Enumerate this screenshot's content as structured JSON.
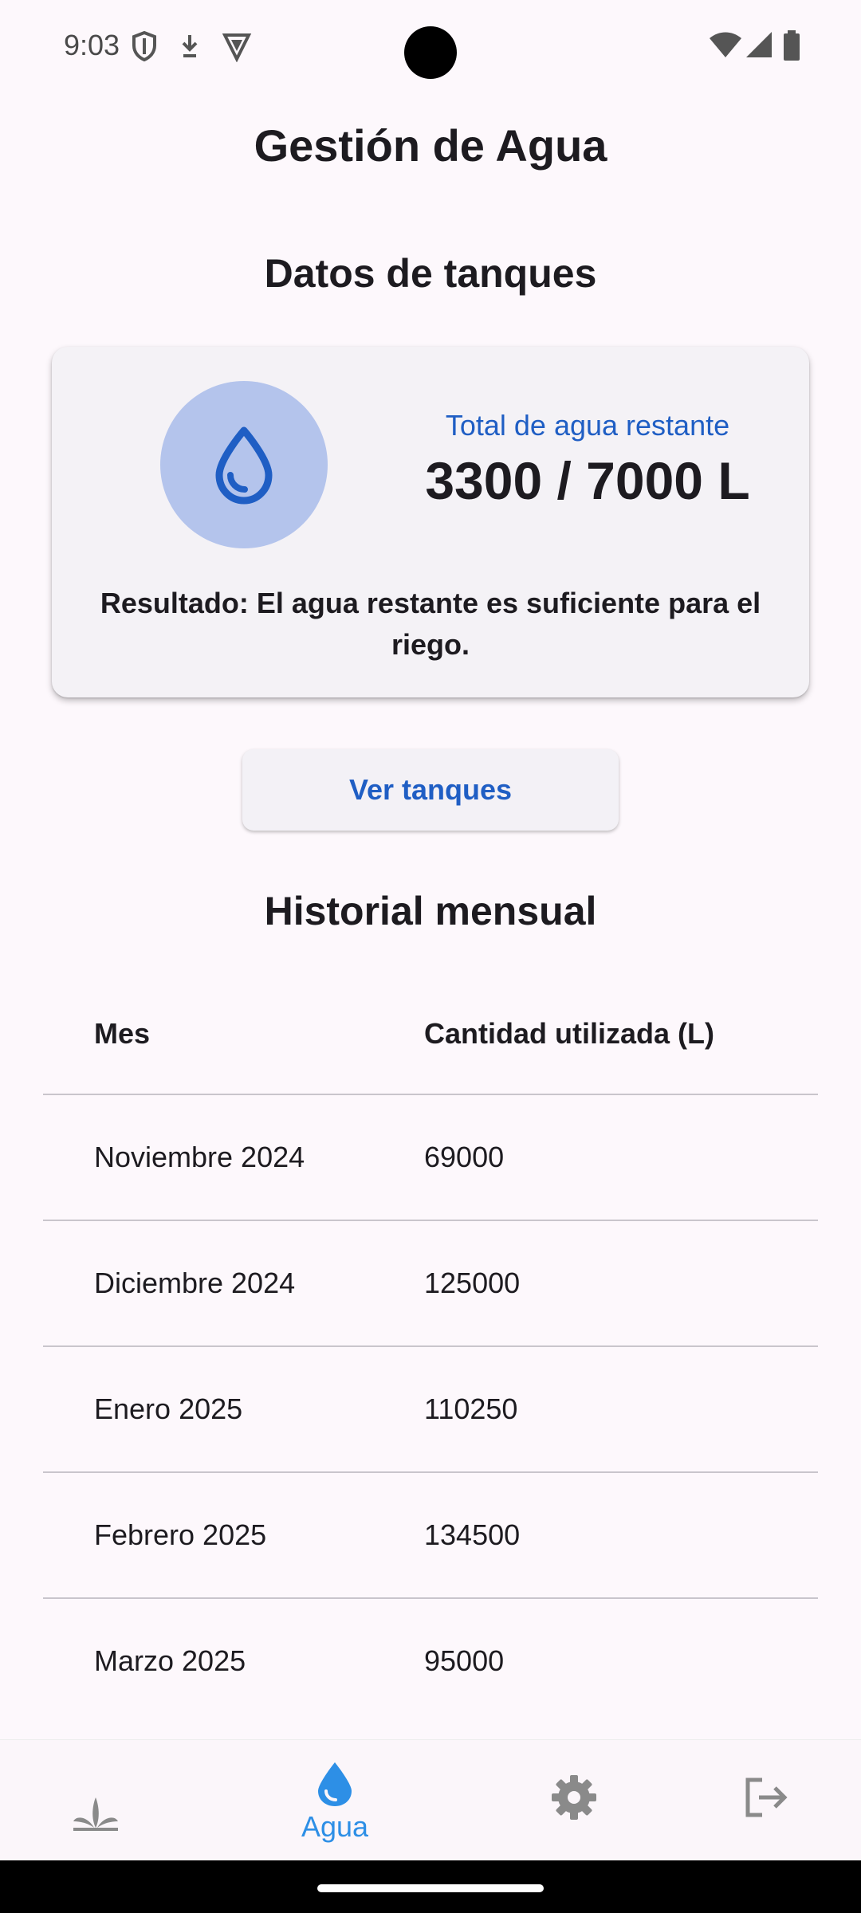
{
  "status_bar": {
    "time": "9:03"
  },
  "page": {
    "title": "Gestión de Agua"
  },
  "tanks": {
    "section_title": "Datos de tanques",
    "label": "Total de agua restante",
    "value": "3300 / 7000 L",
    "result": "Resultado: El agua restante es suficiente para el riego.",
    "button": "Ver tanques"
  },
  "history": {
    "section_title": "Historial mensual",
    "columns": [
      "Mes",
      "Cantidad utilizada (L)"
    ],
    "rows": [
      {
        "month": "Noviembre 2024",
        "amount": "69000"
      },
      {
        "month": "Diciembre 2024",
        "amount": "125000"
      },
      {
        "month": "Enero 2025",
        "amount": "110250"
      },
      {
        "month": "Febrero 2025",
        "amount": "134500"
      },
      {
        "month": "Marzo 2025",
        "amount": "95000"
      }
    ]
  },
  "nav": {
    "items": [
      {
        "icon": "plant-icon",
        "label": ""
      },
      {
        "icon": "water-drop-icon",
        "label": "Agua",
        "active": true
      },
      {
        "icon": "gear-icon",
        "label": ""
      },
      {
        "icon": "logout-icon",
        "label": ""
      }
    ],
    "active_color": "#2d8fe6",
    "inactive_color": "#8a8a8a"
  },
  "colors": {
    "accent": "#1f5ec4",
    "circle_bg": "#b4c4ec"
  }
}
